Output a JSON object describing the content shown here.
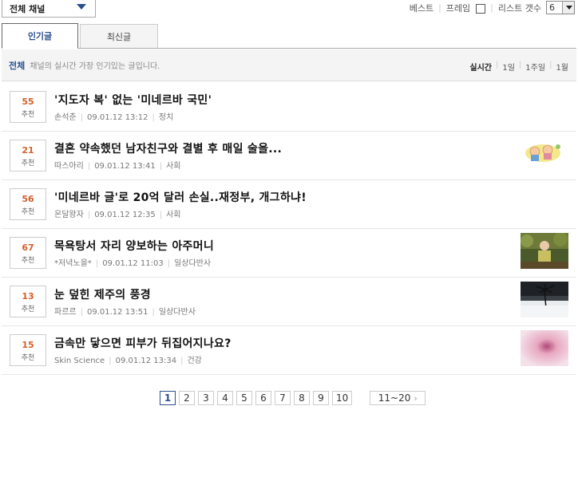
{
  "top": {
    "channel_label": "전체 채널",
    "best_label": "베스트",
    "frame_label": "프레임",
    "count_label": "리스트 갯수",
    "count_value": "6"
  },
  "tabs": [
    {
      "label": "인기글"
    },
    {
      "label": "최신글"
    }
  ],
  "subheader": {
    "category": "전체",
    "description": "채널의 실시간 가장 인기있는 글입니다.",
    "periods": [
      "실시간",
      "1일",
      "1주일",
      "1월"
    ]
  },
  "posts": [
    {
      "recommend": "55",
      "rec_label": "추천",
      "title": "'지도자 복' 없는 '미네르바 국민'",
      "author": "손석춘",
      "date": "09.01.12 13:12",
      "category": "정치",
      "thumb": "none"
    },
    {
      "recommend": "21",
      "rec_label": "추천",
      "title": "결혼 약속했던 남자친구와 결별 후 매일 술을...",
      "author": "따스아리",
      "date": "09.01.12 13:41",
      "category": "사회",
      "thumb": "cartoon"
    },
    {
      "recommend": "56",
      "rec_label": "추천",
      "title": "'미네르바 글'로 20억 달러 손실..재정부, 개그하냐!",
      "author": "온달왕자",
      "date": "09.01.12 12:35",
      "category": "사회",
      "thumb": "none"
    },
    {
      "recommend": "67",
      "rec_label": "추천",
      "title": "목욕탕서 자리 양보하는 아주머니",
      "author": "*저녁노을*",
      "date": "09.01.12 11:03",
      "category": "일상다반사",
      "thumb": "person"
    },
    {
      "recommend": "13",
      "rec_label": "추천",
      "title": "눈 덮힌 제주의 풍경",
      "author": "파르르",
      "date": "09.01.12 13:51",
      "category": "일상다반사",
      "thumb": "snow"
    },
    {
      "recommend": "15",
      "rec_label": "추천",
      "title": "금속만 닿으면 피부가 뒤집어지나요?",
      "author": "Skin Science",
      "date": "09.01.12 13:34",
      "category": "건강",
      "thumb": "skin"
    }
  ],
  "pagination": {
    "pages": [
      "1",
      "2",
      "3",
      "4",
      "5",
      "6",
      "7",
      "8",
      "9",
      "10"
    ],
    "current": "1",
    "next_label": "11~20"
  }
}
